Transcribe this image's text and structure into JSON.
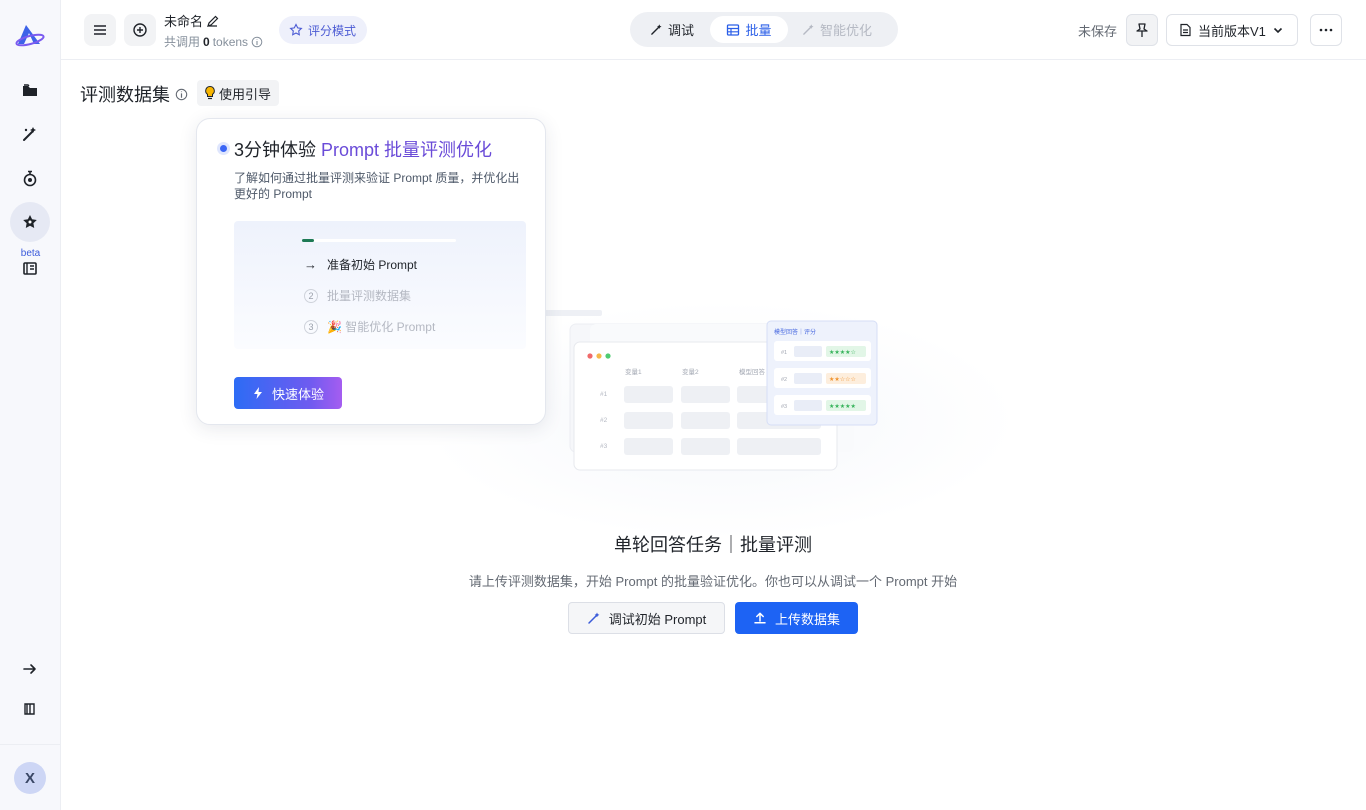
{
  "sidebar": {
    "beta_label": "beta",
    "avatar_text": "X",
    "items": [
      {
        "icon": "folder-icon"
      },
      {
        "icon": "magic-wand-icon"
      },
      {
        "icon": "lab-flask-icon"
      },
      {
        "icon": "star-icon"
      },
      {
        "icon": "book-icon"
      }
    ]
  },
  "header": {
    "doc_title": "未命名",
    "usage_prefix": "共调用",
    "usage_count": "0",
    "usage_suffix": "tokens",
    "mode_label": "评分模式",
    "tabs": [
      {
        "label": "调试"
      },
      {
        "label": "批量"
      },
      {
        "label": "智能优化"
      }
    ],
    "unsaved_label": "未保存",
    "version_label": "当前版本V1"
  },
  "main": {
    "section_title": "评测数据集",
    "guide_label": "使用引导",
    "empty_title": "单轮回答任务｜批量评测",
    "empty_desc": "请上传评测数据集，开始 Prompt 的批量验证优化。你也可以从调试一个 Prompt 开始",
    "debug_button": "调试初始 Prompt",
    "upload_button": "上传数据集"
  },
  "illustration": {
    "col1": "变量1",
    "col2": "变量2",
    "col3": "模型回答",
    "row1": "#1",
    "row2": "#2",
    "row3": "#3",
    "panel_title": "模型回答｜评分"
  },
  "popover": {
    "title_prefix": "3分钟体验 ",
    "title_highlight": "Prompt 批量评测优化",
    "desc": "了解如何通过批量评测来验证 Prompt 质量，并优化出更好的 Prompt",
    "steps": [
      {
        "num": "→",
        "label": "准备初始 Prompt"
      },
      {
        "num": "2",
        "label": "批量评测数据集"
      },
      {
        "num": "3",
        "label": "🎉 智能优化 Prompt"
      }
    ],
    "progress": 0.08,
    "cta": "快速体验"
  },
  "colors": {
    "primary": "#1d63f4",
    "accent_purple": "#6a4bd8",
    "sidebar_bg": "#f7f8fc"
  }
}
